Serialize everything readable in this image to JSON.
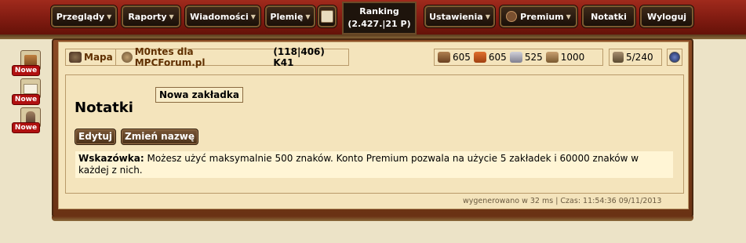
{
  "menu": {
    "przeglady": "Przeglądy",
    "raporty": "Raporty",
    "wiadomosci": "Wiadomości",
    "plemie": "Plemię",
    "ranking_label": "Ranking",
    "ranking_value": "(2.427.|21 P)",
    "ustawienia": "Ustawienia",
    "premium": "Premium",
    "notatki": "Notatki",
    "wyloguj": "Wyloguj"
  },
  "side_notifications": [
    {
      "icon": "building-icon",
      "badge": "Nowe"
    },
    {
      "icon": "envelope-icon",
      "badge": "Nowe"
    },
    {
      "icon": "soldier-icon",
      "badge": "Nowe"
    }
  ],
  "village_bar": {
    "map_label": "Mapa",
    "village_name": "M0ntes dla MPCForum.pl",
    "coords": "(118|406) K41"
  },
  "resources": {
    "wood": "605",
    "clay": "605",
    "iron": "525",
    "storage": "1000",
    "population": "5/240"
  },
  "page": {
    "title": "Notatki",
    "tab_label": "Nowa zakładka",
    "edit_button": "Edytuj",
    "rename_button": "Zmień nazwę",
    "hint_label": "Wskazówka:",
    "hint_text": "Możesz użyć maksymalnie 500 znaków. Konto Premium pozwala na użycie 5 zakładek i 60000 znaków w każdej z nich."
  },
  "footer": {
    "text": "wygenerowano w 32 ms | Czas: 11:54:36 09/11/2013"
  }
}
